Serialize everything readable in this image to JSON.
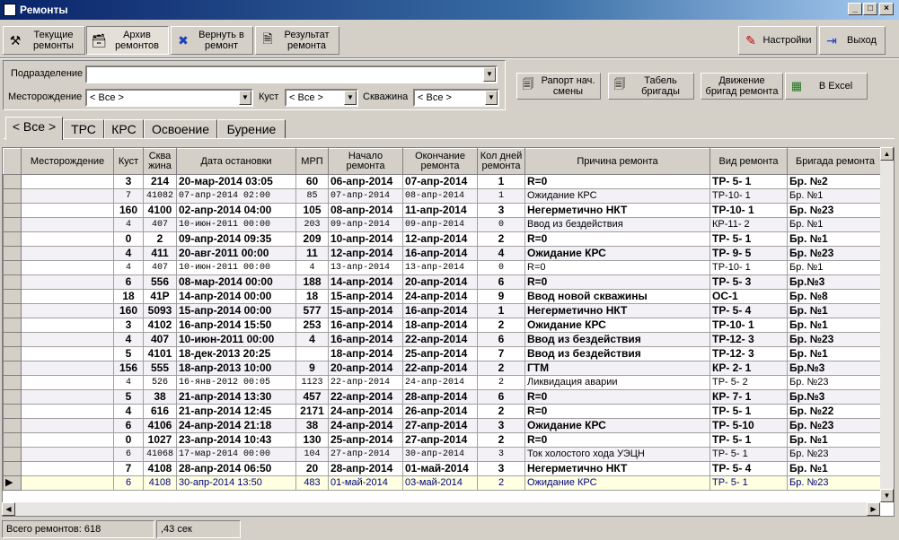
{
  "window": {
    "title": "Ремонты"
  },
  "toolbar": {
    "current": "Текущие\nремонты",
    "archive": "Архив\nремонтов",
    "return": "Вернуть в\nремонт",
    "result": "Результат\nремонта",
    "settings": "Настройки",
    "exit": "Выход"
  },
  "filters": {
    "subdivision_label": "Подразделение",
    "subdivision_value": "",
    "field_label": "Месторождение",
    "field_value": "< Все >",
    "cluster_label": "Куст",
    "cluster_value": "< Все >",
    "well_label": "Скважина",
    "well_value": "< Все >"
  },
  "actions": {
    "shift_report": "Рапорт нач.\nсмены",
    "brigade_table": "Табель\nбригады",
    "brigade_movement": "Движение\nбригад ремонта",
    "excel": "В Excel"
  },
  "tabs": [
    "< Все >",
    "ТРС",
    "КРС",
    "Освоение",
    "Бурение"
  ],
  "grid": {
    "columns": [
      "Месторождение",
      "Куст",
      "Сква\nжина",
      "Дата остановки",
      "МРП",
      "Начало\nремонта",
      "Окончание\nремонта",
      "Кол дней\nремонта",
      "Причина ремонта",
      "Вид ремонта",
      "Бригада ремонта"
    ],
    "rows": [
      {
        "style": "bold",
        "cells": [
          "",
          "3",
          "214",
          "20-мар-2014 03:05",
          "60",
          "06-апр-2014",
          "07-апр-2014",
          "1",
          "R=0",
          "ТР- 5- 1",
          "Бр. №2"
        ]
      },
      {
        "style": "light",
        "cells": [
          "",
          "7",
          "41082",
          "07-апр-2014 02:00",
          "85",
          "07-апр-2014",
          "08-апр-2014",
          "1",
          "Ожидание КРС",
          "ТР-10- 1",
          "Бр. №1"
        ]
      },
      {
        "style": "bold",
        "cells": [
          "",
          "160",
          "4100",
          "02-апр-2014 04:00",
          "105",
          "08-апр-2014",
          "11-апр-2014",
          "3",
          "Негерметично НКТ",
          "ТР-10- 1",
          "Бр. №23"
        ]
      },
      {
        "style": "light",
        "cells": [
          "",
          "4",
          "407",
          "10-июн-2011 00:00",
          "203",
          "09-апр-2014",
          "09-апр-2014",
          "0",
          "Ввод из бездействия",
          "КР-11- 2",
          "Бр. №1"
        ]
      },
      {
        "style": "bold",
        "cells": [
          "",
          "0",
          "2",
          "09-апр-2014 09:35",
          "209",
          "10-апр-2014",
          "12-апр-2014",
          "2",
          "R=0",
          "ТР- 5- 1",
          "Бр. №1"
        ]
      },
      {
        "style": "bold",
        "cells": [
          "",
          "4",
          "411",
          "20-авг-2011 00:00",
          "11",
          "12-апр-2014",
          "16-апр-2014",
          "4",
          "Ожидание КРС",
          "ТР- 9- 5",
          "Бр. №23"
        ]
      },
      {
        "style": "light",
        "cells": [
          "",
          "4",
          "407",
          "10-июн-2011 00:00",
          "4",
          "13-апр-2014",
          "13-апр-2014",
          "0",
          "R=0",
          "ТР-10- 1",
          "Бр. №1"
        ]
      },
      {
        "style": "bold",
        "cells": [
          "",
          "6",
          "556",
          "08-мар-2014 00:00",
          "188",
          "14-апр-2014",
          "20-апр-2014",
          "6",
          "R=0",
          "ТР- 5- 3",
          "Бр.№3"
        ]
      },
      {
        "style": "bold",
        "cells": [
          "",
          "18",
          "41Р",
          "14-апр-2014 00:00",
          "18",
          "15-апр-2014",
          "24-апр-2014",
          "9",
          "Ввод новой скважины",
          "ОС-1",
          "Бр. №8"
        ]
      },
      {
        "style": "bold",
        "cells": [
          "",
          "160",
          "5093",
          "15-апр-2014 00:00",
          "577",
          "15-апр-2014",
          "16-апр-2014",
          "1",
          "Негерметично НКТ",
          "ТР- 5- 4",
          "Бр. №1"
        ]
      },
      {
        "style": "bold",
        "cells": [
          "",
          "3",
          "4102",
          "16-апр-2014 15:50",
          "253",
          "16-апр-2014",
          "18-апр-2014",
          "2",
          "Ожидание КРС",
          "ТР-10- 1",
          "Бр. №1"
        ]
      },
      {
        "style": "bold",
        "cells": [
          "",
          "4",
          "407",
          "10-июн-2011 00:00",
          "4",
          "16-апр-2014",
          "22-апр-2014",
          "6",
          "Ввод из бездействия",
          "ТР-12- 3",
          "Бр. №23"
        ]
      },
      {
        "style": "bold",
        "cells": [
          "",
          "5",
          "4101",
          "18-дек-2013 20:25",
          "",
          "18-апр-2014",
          "25-апр-2014",
          "7",
          "Ввод из бездействия",
          "ТР-12- 3",
          "Бр. №1"
        ]
      },
      {
        "style": "bold",
        "cells": [
          "",
          "156",
          "555",
          "18-апр-2013 10:00",
          "9",
          "20-апр-2014",
          "22-апр-2014",
          "2",
          "ГТМ",
          "КР- 2- 1",
          "Бр.№3"
        ]
      },
      {
        "style": "light",
        "cells": [
          "",
          "4",
          "526",
          "16-янв-2012 00:05",
          "1123",
          "22-апр-2014",
          "24-апр-2014",
          "2",
          "Ликвидация аварии",
          "ТР- 5- 2",
          "Бр. №23"
        ]
      },
      {
        "style": "bold",
        "cells": [
          "",
          "5",
          "38",
          "21-апр-2014 13:30",
          "457",
          "22-апр-2014",
          "28-апр-2014",
          "6",
          "R=0",
          "КР- 7- 1",
          "Бр.№3"
        ]
      },
      {
        "style": "bold",
        "cells": [
          "",
          "4",
          "616",
          "21-апр-2014 12:45",
          "2171",
          "24-апр-2014",
          "26-апр-2014",
          "2",
          "R=0",
          "ТР- 5- 1",
          "Бр. №22"
        ]
      },
      {
        "style": "bold",
        "cells": [
          "",
          "6",
          "4106",
          "24-апр-2014 21:18",
          "38",
          "24-апр-2014",
          "27-апр-2014",
          "3",
          "Ожидание КРС",
          "ТР- 5-10",
          "Бр. №23"
        ]
      },
      {
        "style": "bold",
        "cells": [
          "",
          "0",
          "1027",
          "23-апр-2014 10:43",
          "130",
          "25-апр-2014",
          "27-апр-2014",
          "2",
          "R=0",
          "ТР- 5- 1",
          "Бр. №1"
        ]
      },
      {
        "style": "light",
        "cells": [
          "",
          "6",
          "41068",
          "17-мар-2014 00:00",
          "104",
          "27-апр-2014",
          "30-апр-2014",
          "3",
          "Ток холостого хода УЭЦН",
          "ТР- 5- 1",
          "Бр. №23"
        ]
      },
      {
        "style": "bold",
        "cells": [
          "",
          "7",
          "4108",
          "28-апр-2014 06:50",
          "20",
          "28-апр-2014",
          "01-май-2014",
          "3",
          "Негерметично НКТ",
          "ТР- 5- 4",
          "Бр. №1"
        ]
      },
      {
        "style": "sel",
        "cells": [
          "",
          "6",
          "4108",
          "30-апр-2014 13:50",
          "483",
          "01-май-2014",
          "03-май-2014",
          "2",
          "Ожидание КРС",
          "ТР- 5- 1",
          "Бр. №23"
        ]
      }
    ]
  },
  "status": {
    "total": "Всего ремонтов:  618",
    "time": ",43 сек"
  }
}
